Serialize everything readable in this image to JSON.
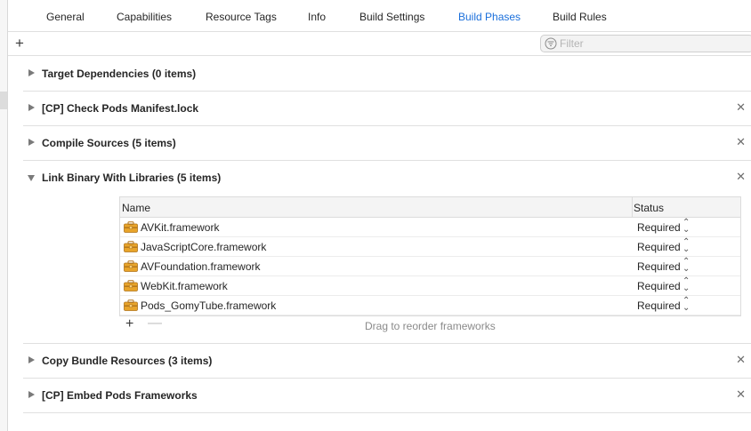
{
  "tabs": [
    {
      "label": "General",
      "active": false
    },
    {
      "label": "Capabilities",
      "active": false
    },
    {
      "label": "Resource Tags",
      "active": false
    },
    {
      "label": "Info",
      "active": false
    },
    {
      "label": "Build Settings",
      "active": false
    },
    {
      "label": "Build Phases",
      "active": true
    },
    {
      "label": "Build Rules",
      "active": false
    }
  ],
  "toolbar": {
    "add_label": "+",
    "filter_placeholder": "Filter",
    "filter_value": ""
  },
  "phases": [
    {
      "title": "Target Dependencies (0 items)",
      "expanded": false,
      "removable": false
    },
    {
      "title": "[CP] Check Pods Manifest.lock",
      "expanded": false,
      "removable": true
    },
    {
      "title": "Compile Sources (5 items)",
      "expanded": false,
      "removable": true
    },
    {
      "title": "Link Binary With Libraries (5 items)",
      "expanded": true,
      "removable": true
    },
    {
      "title": "Copy Bundle Resources (3 items)",
      "expanded": false,
      "removable": true
    },
    {
      "title": "[CP] Embed Pods Frameworks",
      "expanded": false,
      "removable": true
    }
  ],
  "libraries": {
    "columns": {
      "name": "Name",
      "status": "Status"
    },
    "rows": [
      {
        "name": "AVKit.framework",
        "status": "Required"
      },
      {
        "name": "JavaScriptCore.framework",
        "status": "Required"
      },
      {
        "name": "AVFoundation.framework",
        "status": "Required"
      },
      {
        "name": "WebKit.framework",
        "status": "Required"
      },
      {
        "name": "Pods_GomyTube.framework",
        "status": "Required"
      }
    ],
    "add_label": "+",
    "remove_label": "—",
    "hint": "Drag to reorder frameworks"
  },
  "icons": {
    "close": "close-icon",
    "stepper": "up-down-chevron-icon",
    "framework": "toolbox-icon",
    "filter": "filter-icon"
  },
  "colors": {
    "accent": "#1a6fdb",
    "framework_icon": "#e8a42a"
  }
}
